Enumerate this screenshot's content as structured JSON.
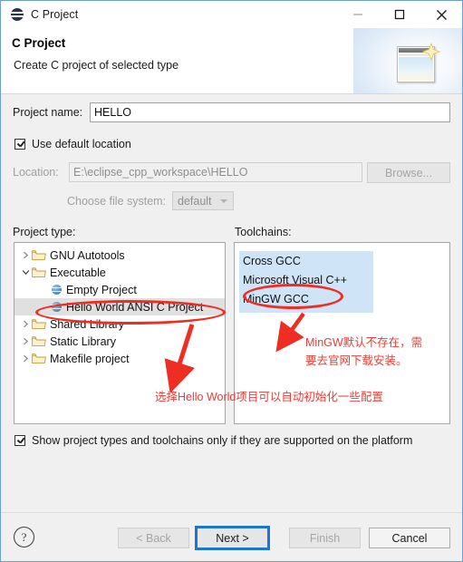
{
  "window": {
    "title": "C Project",
    "app_icon": "eclipse-sphere-icon",
    "controls": {
      "minimize": "minimize-icon",
      "maximize": "maximize-icon",
      "close": "close-icon"
    }
  },
  "header": {
    "title": "C Project",
    "subtitle": "Create C project of selected type",
    "banner_icon": "new-project-wizard-icon"
  },
  "form": {
    "project_name_label": "Project name:",
    "project_name_value": "HELLO",
    "use_default_location_label": "Use default location",
    "use_default_location_checked": true,
    "location_label": "Location:",
    "location_value": "E:\\eclipse_cpp_workspace\\HELLO",
    "browse_label": "Browse...",
    "file_system_label": "Choose file system:",
    "file_system_value": "default"
  },
  "project_type": {
    "label": "Project type:",
    "items": [
      {
        "label": "GNU Autotools",
        "icon": "folder-icon",
        "twisty": "collapsed",
        "indent": 0,
        "selected": false
      },
      {
        "label": "Executable",
        "icon": "folder-icon",
        "twisty": "expanded",
        "indent": 0,
        "selected": false
      },
      {
        "label": "Empty Project",
        "icon": "project-icon",
        "twisty": "none",
        "indent": 1,
        "selected": false
      },
      {
        "label": "Hello World ANSI C Project",
        "icon": "project-icon",
        "twisty": "none",
        "indent": 1,
        "selected": true
      },
      {
        "label": "Shared Library",
        "icon": "folder-icon",
        "twisty": "collapsed",
        "indent": 0,
        "selected": false
      },
      {
        "label": "Static Library",
        "icon": "folder-icon",
        "twisty": "collapsed",
        "indent": 0,
        "selected": false
      },
      {
        "label": "Makefile project",
        "icon": "folder-icon",
        "twisty": "collapsed",
        "indent": 0,
        "selected": false
      }
    ]
  },
  "toolchains": {
    "label": "Toolchains:",
    "items": [
      {
        "label": "Cross GCC",
        "highlighted": true
      },
      {
        "label": "Microsoft Visual C++",
        "highlighted": true
      },
      {
        "label": "MinGW GCC",
        "highlighted": true
      }
    ]
  },
  "show_supported": {
    "label": "Show project types and toolchains only if they are supported on the platform",
    "checked": true
  },
  "annotations": {
    "color": "#ee3b35",
    "project_type_note": "选择Hello World项目可以自动初始化一些配置",
    "toolchain_note_line1": "MinGW默认不存在，需",
    "toolchain_note_line2": "要去官网下载安装。"
  },
  "footer": {
    "help_icon": "help-icon",
    "back_label": "< Back",
    "back_enabled": false,
    "next_label": "Next >",
    "next_enabled": true,
    "finish_label": "Finish",
    "finish_enabled": false,
    "cancel_label": "Cancel",
    "cancel_enabled": true
  }
}
